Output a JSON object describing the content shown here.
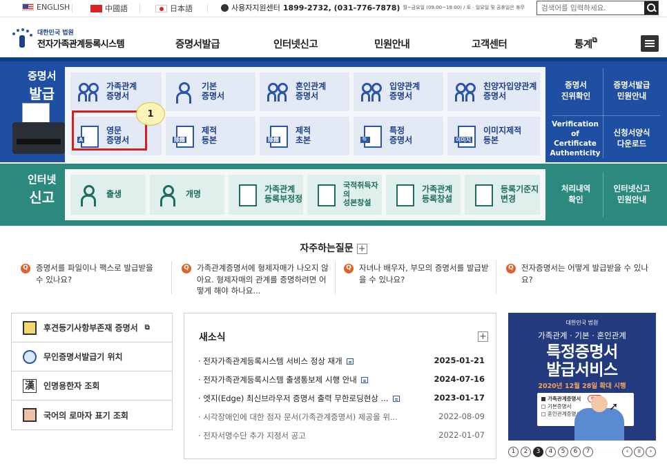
{
  "topbar": {
    "lang_en": "ENGLISH",
    "lang_cn": "中國語",
    "lang_jp": "日本語",
    "callcenter_label": "사용자지원센터",
    "callcenter_phone": "1899-2732, (031-776-7878)",
    "callcenter_hours": "월~금요일 (09:00~18:00) / 토 · 일요일 및 공휴일은 휴무",
    "search_placeholder": "검색어를 입력하세요."
  },
  "header": {
    "logo_small": "대한민국 법원",
    "logo_big": "전자가족관계등록시스템",
    "nav": [
      "증명서발급",
      "인터넷신고",
      "민원안내",
      "고객센터",
      "통계"
    ]
  },
  "cert_section": {
    "title_line1": "증명서",
    "title_line2": "발급",
    "tiles": [
      {
        "line1": "가족관계",
        "line2": "증명서"
      },
      {
        "line1": "기본",
        "line2": "증명서"
      },
      {
        "line1": "혼인관계",
        "line2": "증명서"
      },
      {
        "line1": "입양관계",
        "line2": "증명서"
      },
      {
        "line1": "친양자입양관계",
        "line2": "증명서"
      },
      {
        "line1": "영문",
        "line2": "증명서"
      },
      {
        "line1": "제적",
        "line2": "등본"
      },
      {
        "line1": "제적",
        "line2": "초본"
      },
      {
        "line1": "특정",
        "line2": "증명서"
      },
      {
        "line1": "이미지제적",
        "line2": "등본"
      }
    ],
    "side_links": [
      {
        "line1": "증명서",
        "line2": "진위확인"
      },
      {
        "line1": "증명서발급",
        "line2": "민원안내"
      },
      {
        "line1": "Verification of",
        "line2": "Certificate",
        "line3": "Authenticity"
      },
      {
        "line1": "신청서양식",
        "line2": "다운로드"
      }
    ],
    "callout_number": "1",
    "glyph_jeonjeok": "除籍",
    "glyph_image": "이미지"
  },
  "report_section": {
    "title_line1": "인터넷",
    "title_line2": "신고",
    "tiles": [
      {
        "line1": "출생",
        "line2": ""
      },
      {
        "line1": "개명",
        "line2": ""
      },
      {
        "line1": "가족관계",
        "line2": "등록부정정"
      },
      {
        "line1": "국적취득자의",
        "line2": "성본창설"
      },
      {
        "line1": "가족관계",
        "line2": "등록창설"
      },
      {
        "line1": "등록기준지",
        "line2": "변경"
      }
    ],
    "side_links": [
      {
        "line1": "처리내역",
        "line2": "확인"
      },
      {
        "line1": "인터넷신고",
        "line2": "민원안내"
      }
    ]
  },
  "faq": {
    "title": "자주하는질문",
    "plus": "+",
    "items": [
      "증명서를 파일이나 팩스로 발급받을 수 있나요?",
      "가족관계증명서에 형제자매가 나오지 않아요. 형제자매의 관계를 증명하려면 어떻게 해야 하나요...",
      "자녀나 배우자, 부모의 증명서를 발급받을 수 있나요?",
      "전자증명서는 어떻게 발급받을 수 있나요?"
    ],
    "q_mark": "Q"
  },
  "quick_links": [
    "후견등기사항부존재 증명서",
    "무인증명서발급기 위치",
    "인명용한자 조회",
    "국어의 로마자 표기 조회"
  ],
  "quick_han_glyph": "漢",
  "news": {
    "title": "새소식",
    "plus": "+",
    "items": [
      {
        "title": "전자가족관계등록시스템 서비스 정상 재개",
        "date": "2025-01-21"
      },
      {
        "title": "전자가족관계등록시스템 출생통보제 시행 안내",
        "date": "2024-07-16"
      },
      {
        "title": "엣지(Edge) 최신브라우저 증명서 출력 무한로딩현상 ...",
        "date": "2023-01-17"
      },
      {
        "title": "시각장애인에 대한 점자 문서(가족관계증명서) 제공을 위...",
        "date": "2022-08-09"
      },
      {
        "title": "전자서명수단 추가 지정서 공고",
        "date": "2022-01-07"
      }
    ]
  },
  "banner": {
    "brand": "대한민국 법원",
    "sub": "가족관계 · 기본 · 혼인관계",
    "headline1": "특정증명서",
    "headline2": "발급서비스",
    "date": "2020년 12월 28일 확대 시행",
    "card_row1": "가족관계증명서",
    "card_pill": "특정",
    "card_row2": "기본증명서",
    "card_row3": "혼인관계증명서",
    "card_row3_pill": "특정)"
  },
  "slider": {
    "pages": [
      "1",
      "2",
      "3",
      "4",
      "5",
      "6",
      "7"
    ],
    "active_page": "3",
    "prev": "‹",
    "pause": "॥",
    "next": "›"
  },
  "colors": {
    "cert_band": "#1e4fa3",
    "report_band": "#2b8a7d",
    "highlight": "#d21f1f",
    "faq_icon": "#e0612a"
  }
}
